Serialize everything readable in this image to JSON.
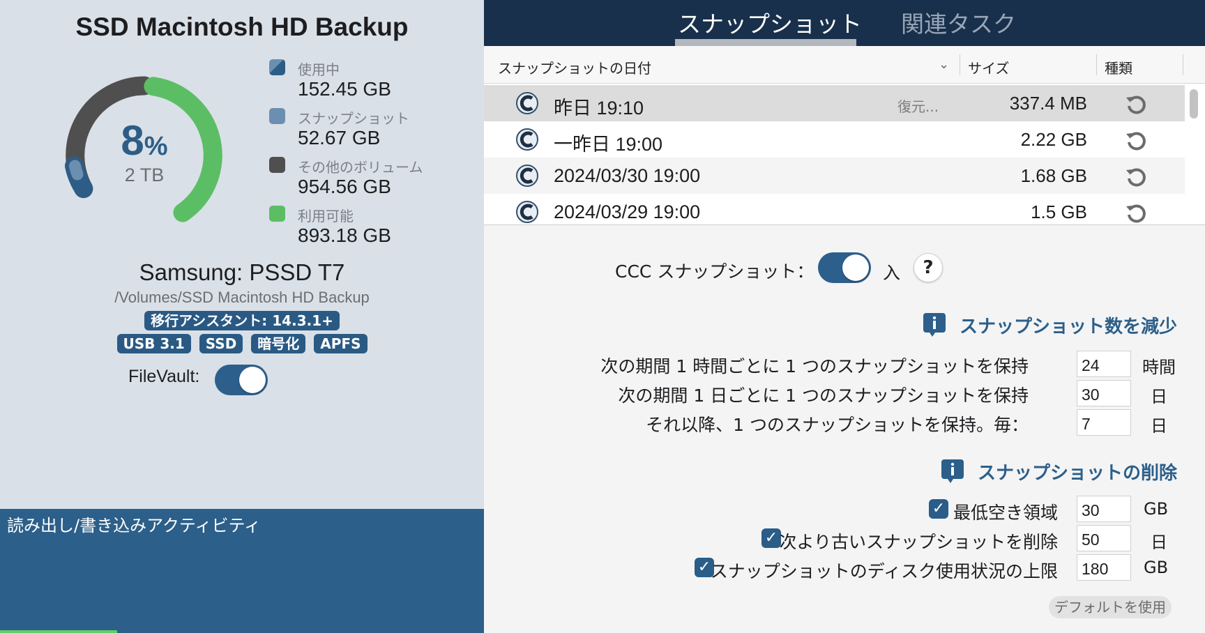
{
  "volume": {
    "title": "SSD Macintosh HD Backup",
    "percent_number": "8",
    "percent_sign": "%",
    "capacity": "2 TB",
    "legend": [
      {
        "label": "使用中",
        "value": "152.45 GB",
        "color": "#2d5d86",
        "icon": "used-swatch"
      },
      {
        "label": "スナップショット",
        "value": "52.67 GB",
        "color": "#6b8fb0",
        "icon": "snapshot-swatch"
      },
      {
        "label": "その他のボリューム",
        "value": "954.56 GB",
        "color": "#4f4f50",
        "icon": "other-volumes-swatch"
      },
      {
        "label": "利用可能",
        "value": "893.18 GB",
        "color": "#5cbe64",
        "icon": "available-swatch"
      }
    ],
    "device_name": "Samsung: PSSD T7",
    "mount_path": "/Volumes/SSD Macintosh HD Backup",
    "migration_badge": "移行アシスタント: 14.3.1+",
    "badges": [
      "USB 3.1",
      "SSD",
      "暗号化",
      "APFS"
    ],
    "filevault_label": "FileVault:",
    "filevault_on": true
  },
  "activity": {
    "label": "読み出し/書き込みアクティビティ",
    "color": "#2c5f89"
  },
  "tabs": [
    {
      "label": "スナップショット",
      "active": true
    },
    {
      "label": "関連タスク",
      "active": false
    }
  ],
  "table": {
    "columns": [
      "スナップショットの日付",
      "サイズ",
      "種類"
    ],
    "rows": [
      {
        "date": "昨日 19:10",
        "restore": "復元...",
        "size": "337.4 MB",
        "selected": true
      },
      {
        "date": "一昨日 19:00",
        "restore": "",
        "size": "2.22 GB",
        "selected": false
      },
      {
        "date": "2024/03/30 19:00",
        "restore": "",
        "size": "1.68 GB",
        "selected": false
      },
      {
        "date": "2024/03/29 19:00",
        "restore": "",
        "size": "1.5 GB",
        "selected": false
      }
    ]
  },
  "settings": {
    "ccc_label": "CCC スナップショット：",
    "ccc_state": "入",
    "help_label": "?",
    "reduce_heading": "スナップショット数を減少",
    "reduce_rows": [
      {
        "label": "次の期間 1 時間ごとに 1 つのスナップショットを保持",
        "value": "24",
        "unit": "時間"
      },
      {
        "label": "次の期間 1 日ごとに 1 つのスナップショットを保持",
        "value": "30",
        "unit": "日"
      },
      {
        "label": "それ以降、1 つのスナップショットを保持。毎：",
        "value": "7",
        "unit": "日"
      }
    ],
    "delete_heading": "スナップショットの削除",
    "delete_rows": [
      {
        "label": "最低空き領域",
        "value": "30",
        "unit": "GB",
        "checked": true
      },
      {
        "label": "次より古いスナップショットを削除",
        "value": "50",
        "unit": "日",
        "checked": true
      },
      {
        "label": "スナップショットのディスク使用状況の上限",
        "value": "180",
        "unit": "GB",
        "checked": true
      }
    ],
    "default_button": "デフォルトを使用"
  }
}
